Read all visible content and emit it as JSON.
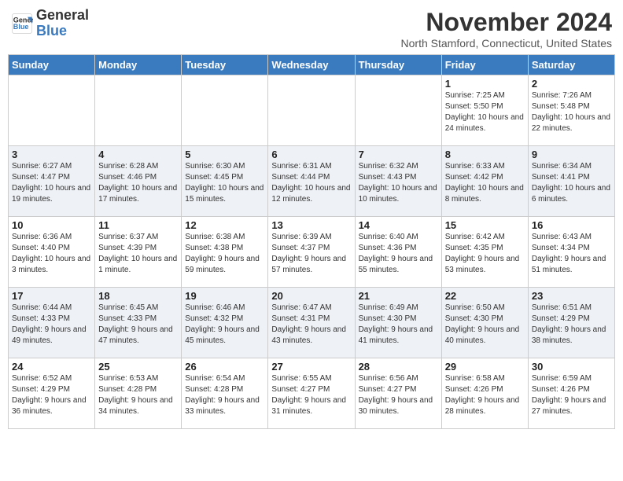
{
  "header": {
    "logo_line1": "General",
    "logo_line2": "Blue",
    "month": "November 2024",
    "location": "North Stamford, Connecticut, United States"
  },
  "days_of_week": [
    "Sunday",
    "Monday",
    "Tuesday",
    "Wednesday",
    "Thursday",
    "Friday",
    "Saturday"
  ],
  "weeks": [
    [
      {
        "day": "",
        "info": ""
      },
      {
        "day": "",
        "info": ""
      },
      {
        "day": "",
        "info": ""
      },
      {
        "day": "",
        "info": ""
      },
      {
        "day": "",
        "info": ""
      },
      {
        "day": "1",
        "info": "Sunrise: 7:25 AM\nSunset: 5:50 PM\nDaylight: 10 hours and 24 minutes."
      },
      {
        "day": "2",
        "info": "Sunrise: 7:26 AM\nSunset: 5:48 PM\nDaylight: 10 hours and 22 minutes."
      }
    ],
    [
      {
        "day": "3",
        "info": "Sunrise: 6:27 AM\nSunset: 4:47 PM\nDaylight: 10 hours and 19 minutes."
      },
      {
        "day": "4",
        "info": "Sunrise: 6:28 AM\nSunset: 4:46 PM\nDaylight: 10 hours and 17 minutes."
      },
      {
        "day": "5",
        "info": "Sunrise: 6:30 AM\nSunset: 4:45 PM\nDaylight: 10 hours and 15 minutes."
      },
      {
        "day": "6",
        "info": "Sunrise: 6:31 AM\nSunset: 4:44 PM\nDaylight: 10 hours and 12 minutes."
      },
      {
        "day": "7",
        "info": "Sunrise: 6:32 AM\nSunset: 4:43 PM\nDaylight: 10 hours and 10 minutes."
      },
      {
        "day": "8",
        "info": "Sunrise: 6:33 AM\nSunset: 4:42 PM\nDaylight: 10 hours and 8 minutes."
      },
      {
        "day": "9",
        "info": "Sunrise: 6:34 AM\nSunset: 4:41 PM\nDaylight: 10 hours and 6 minutes."
      }
    ],
    [
      {
        "day": "10",
        "info": "Sunrise: 6:36 AM\nSunset: 4:40 PM\nDaylight: 10 hours and 3 minutes."
      },
      {
        "day": "11",
        "info": "Sunrise: 6:37 AM\nSunset: 4:39 PM\nDaylight: 10 hours and 1 minute."
      },
      {
        "day": "12",
        "info": "Sunrise: 6:38 AM\nSunset: 4:38 PM\nDaylight: 9 hours and 59 minutes."
      },
      {
        "day": "13",
        "info": "Sunrise: 6:39 AM\nSunset: 4:37 PM\nDaylight: 9 hours and 57 minutes."
      },
      {
        "day": "14",
        "info": "Sunrise: 6:40 AM\nSunset: 4:36 PM\nDaylight: 9 hours and 55 minutes."
      },
      {
        "day": "15",
        "info": "Sunrise: 6:42 AM\nSunset: 4:35 PM\nDaylight: 9 hours and 53 minutes."
      },
      {
        "day": "16",
        "info": "Sunrise: 6:43 AM\nSunset: 4:34 PM\nDaylight: 9 hours and 51 minutes."
      }
    ],
    [
      {
        "day": "17",
        "info": "Sunrise: 6:44 AM\nSunset: 4:33 PM\nDaylight: 9 hours and 49 minutes."
      },
      {
        "day": "18",
        "info": "Sunrise: 6:45 AM\nSunset: 4:33 PM\nDaylight: 9 hours and 47 minutes."
      },
      {
        "day": "19",
        "info": "Sunrise: 6:46 AM\nSunset: 4:32 PM\nDaylight: 9 hours and 45 minutes."
      },
      {
        "day": "20",
        "info": "Sunrise: 6:47 AM\nSunset: 4:31 PM\nDaylight: 9 hours and 43 minutes."
      },
      {
        "day": "21",
        "info": "Sunrise: 6:49 AM\nSunset: 4:30 PM\nDaylight: 9 hours and 41 minutes."
      },
      {
        "day": "22",
        "info": "Sunrise: 6:50 AM\nSunset: 4:30 PM\nDaylight: 9 hours and 40 minutes."
      },
      {
        "day": "23",
        "info": "Sunrise: 6:51 AM\nSunset: 4:29 PM\nDaylight: 9 hours and 38 minutes."
      }
    ],
    [
      {
        "day": "24",
        "info": "Sunrise: 6:52 AM\nSunset: 4:29 PM\nDaylight: 9 hours and 36 minutes."
      },
      {
        "day": "25",
        "info": "Sunrise: 6:53 AM\nSunset: 4:28 PM\nDaylight: 9 hours and 34 minutes."
      },
      {
        "day": "26",
        "info": "Sunrise: 6:54 AM\nSunset: 4:28 PM\nDaylight: 9 hours and 33 minutes."
      },
      {
        "day": "27",
        "info": "Sunrise: 6:55 AM\nSunset: 4:27 PM\nDaylight: 9 hours and 31 minutes."
      },
      {
        "day": "28",
        "info": "Sunrise: 6:56 AM\nSunset: 4:27 PM\nDaylight: 9 hours and 30 minutes."
      },
      {
        "day": "29",
        "info": "Sunrise: 6:58 AM\nSunset: 4:26 PM\nDaylight: 9 hours and 28 minutes."
      },
      {
        "day": "30",
        "info": "Sunrise: 6:59 AM\nSunset: 4:26 PM\nDaylight: 9 hours and 27 minutes."
      }
    ]
  ]
}
